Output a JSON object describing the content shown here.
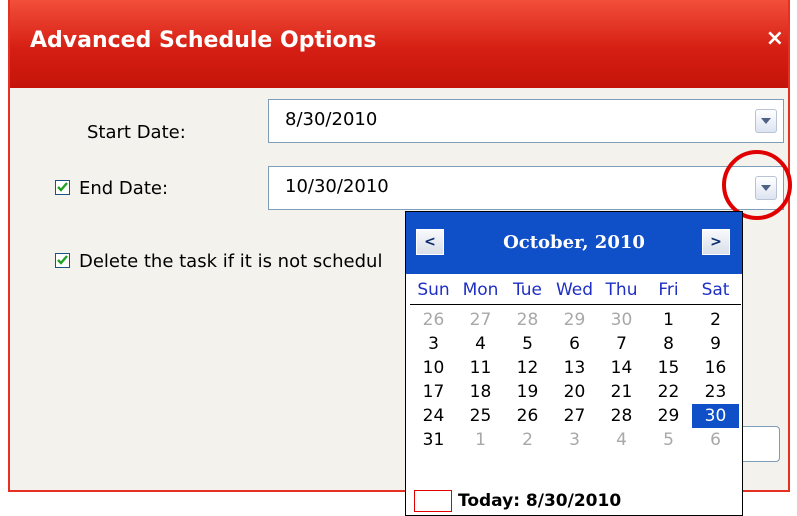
{
  "dialog": {
    "title": "Advanced Schedule Options",
    "close_glyph": "×",
    "accent_color": "#d61f14"
  },
  "start_date": {
    "label": "Start Date:",
    "value": "8/30/2010"
  },
  "end_date": {
    "label": "End Date:",
    "value": "10/30/2010",
    "checked": true
  },
  "delete_option": {
    "label": "Delete the task if it is not schedul",
    "checked": true
  },
  "calendar": {
    "month_label": "October, 2010",
    "prev_glyph": "<",
    "next_glyph": ">",
    "weekdays": [
      "Sun",
      "Mon",
      "Tue",
      "Wed",
      "Thu",
      "Fri",
      "Sat"
    ],
    "weeks": [
      [
        {
          "d": "26",
          "other": true
        },
        {
          "d": "27",
          "other": true
        },
        {
          "d": "28",
          "other": true
        },
        {
          "d": "29",
          "other": true
        },
        {
          "d": "30",
          "other": true
        },
        {
          "d": "1"
        },
        {
          "d": "2"
        }
      ],
      [
        {
          "d": "3"
        },
        {
          "d": "4"
        },
        {
          "d": "5"
        },
        {
          "d": "6"
        },
        {
          "d": "7"
        },
        {
          "d": "8"
        },
        {
          "d": "9"
        }
      ],
      [
        {
          "d": "10"
        },
        {
          "d": "11"
        },
        {
          "d": "12"
        },
        {
          "d": "13"
        },
        {
          "d": "14"
        },
        {
          "d": "15"
        },
        {
          "d": "16"
        }
      ],
      [
        {
          "d": "17"
        },
        {
          "d": "18"
        },
        {
          "d": "19"
        },
        {
          "d": "20"
        },
        {
          "d": "21"
        },
        {
          "d": "22"
        },
        {
          "d": "23"
        }
      ],
      [
        {
          "d": "24"
        },
        {
          "d": "25"
        },
        {
          "d": "26"
        },
        {
          "d": "27"
        },
        {
          "d": "28"
        },
        {
          "d": "29"
        },
        {
          "d": "30",
          "selected": true
        }
      ],
      [
        {
          "d": "31"
        },
        {
          "d": "1",
          "other": true
        },
        {
          "d": "2",
          "other": true
        },
        {
          "d": "3",
          "other": true
        },
        {
          "d": "4",
          "other": true
        },
        {
          "d": "5",
          "other": true
        },
        {
          "d": "6",
          "other": true
        }
      ]
    ],
    "today_label": "Today: 8/30/2010",
    "header_color": "#0f4fc8"
  },
  "icons": {
    "dropdown": "chevron-down-icon",
    "close": "close-icon",
    "checkmark": "checkmark-icon"
  }
}
